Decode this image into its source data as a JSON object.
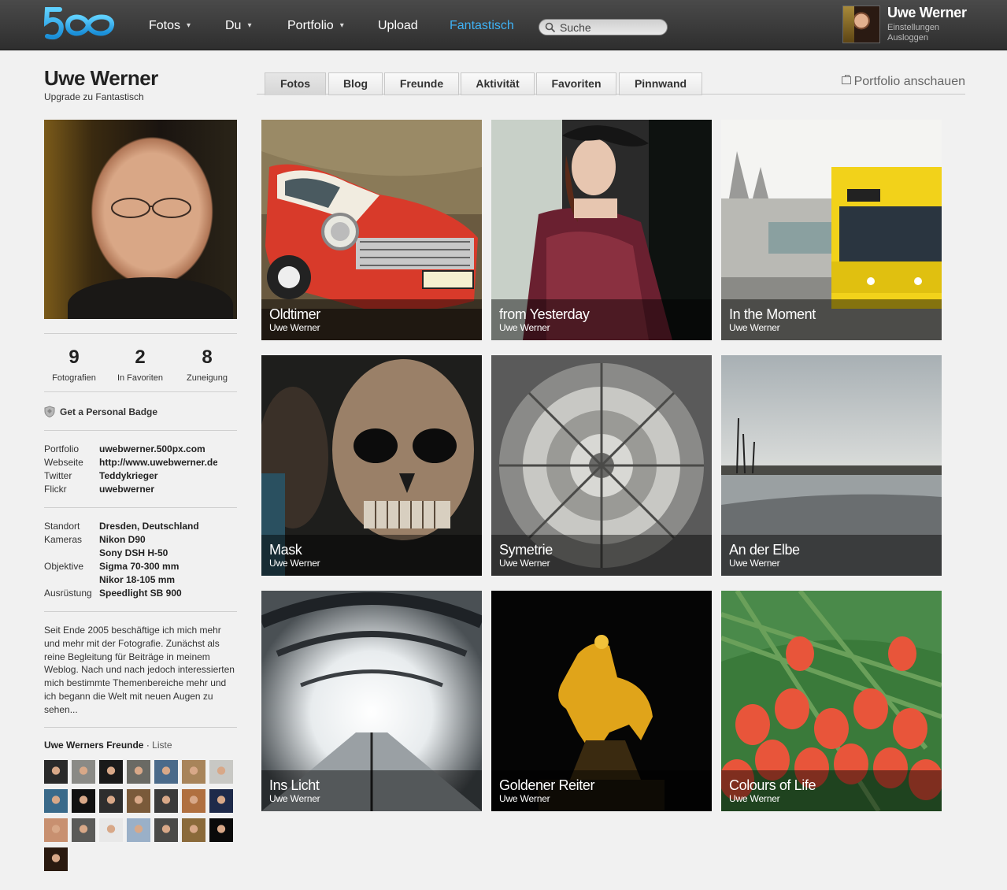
{
  "header": {
    "logo_text": "500",
    "nav": [
      {
        "label": "Fotos",
        "dropdown": true
      },
      {
        "label": "Du",
        "dropdown": true
      },
      {
        "label": "Portfolio",
        "dropdown": true
      },
      {
        "label": "Upload",
        "dropdown": false
      },
      {
        "label": "Fantastisch",
        "dropdown": false,
        "active": true
      }
    ],
    "caret": "▾",
    "search_placeholder": "Suche",
    "user": {
      "name": "Uwe Werner",
      "settings_label": "Einstellungen",
      "logout_label": "Ausloggen"
    },
    "accent_color": "#3fb2f5"
  },
  "profile": {
    "name": "Uwe Werner",
    "upgrade_label": "Upgrade zu Fantastisch",
    "stats": [
      {
        "value": "9",
        "label": "Fotografien"
      },
      {
        "value": "2",
        "label": "In Favoriten"
      },
      {
        "value": "8",
        "label": "Zuneigung"
      }
    ],
    "badge_label": "Get a Personal Badge",
    "links": [
      {
        "key": "Portfolio",
        "value": "uwebwerner.500px.com"
      },
      {
        "key": "Webseite",
        "value": "http://www.uwebwerner.de"
      },
      {
        "key": "Twitter",
        "value": "Teddykrieger"
      },
      {
        "key": "Flickr",
        "value": "uwebwerner"
      }
    ],
    "details": [
      {
        "key": "Standort",
        "value": "Dresden, Deutschland"
      },
      {
        "key": "Kameras",
        "value": "Nikon D90"
      },
      {
        "key": "",
        "value": "Sony DSH H-50"
      },
      {
        "key": "Objektive",
        "value": "Sigma 70-300 mm"
      },
      {
        "key": "",
        "value": "Nikor 18-105 mm"
      },
      {
        "key": "Ausrüstung",
        "value": "Speedlight SB 900"
      }
    ],
    "bio": "Seit Ende 2005 beschäftige ich mich mehr und mehr mit der Fotografie. Zunächst als reine Begleitung für Beiträge in meinem Weblog. Nach und nach jedoch interessierten mich bestimmte Themenbereiche mehr und ich begann die Welt mit neuen Augen zu sehen...",
    "friends_title": "Uwe Werners Freunde",
    "friends_separator": " · ",
    "friends_list_label": "Liste",
    "friends_count": 22
  },
  "tabs": {
    "items": [
      "Fotos",
      "Blog",
      "Freunde",
      "Aktivität",
      "Favoriten",
      "Pinnwand"
    ],
    "active": "Fotos",
    "portfolio_link": "Portfolio anschauen"
  },
  "photos": [
    {
      "title": "Oldtimer",
      "author": "Uwe Werner"
    },
    {
      "title": "from Yesterday",
      "author": "Uwe Werner"
    },
    {
      "title": "In the Moment",
      "author": "Uwe Werner"
    },
    {
      "title": "Mask",
      "author": "Uwe Werner"
    },
    {
      "title": "Symetrie",
      "author": "Uwe Werner"
    },
    {
      "title": "An der Elbe",
      "author": "Uwe Werner"
    },
    {
      "title": "Ins Licht",
      "author": "Uwe Werner"
    },
    {
      "title": "Goldener Reiter",
      "author": "Uwe Werner"
    },
    {
      "title": "Colours of Life",
      "author": "Uwe Werner"
    }
  ]
}
